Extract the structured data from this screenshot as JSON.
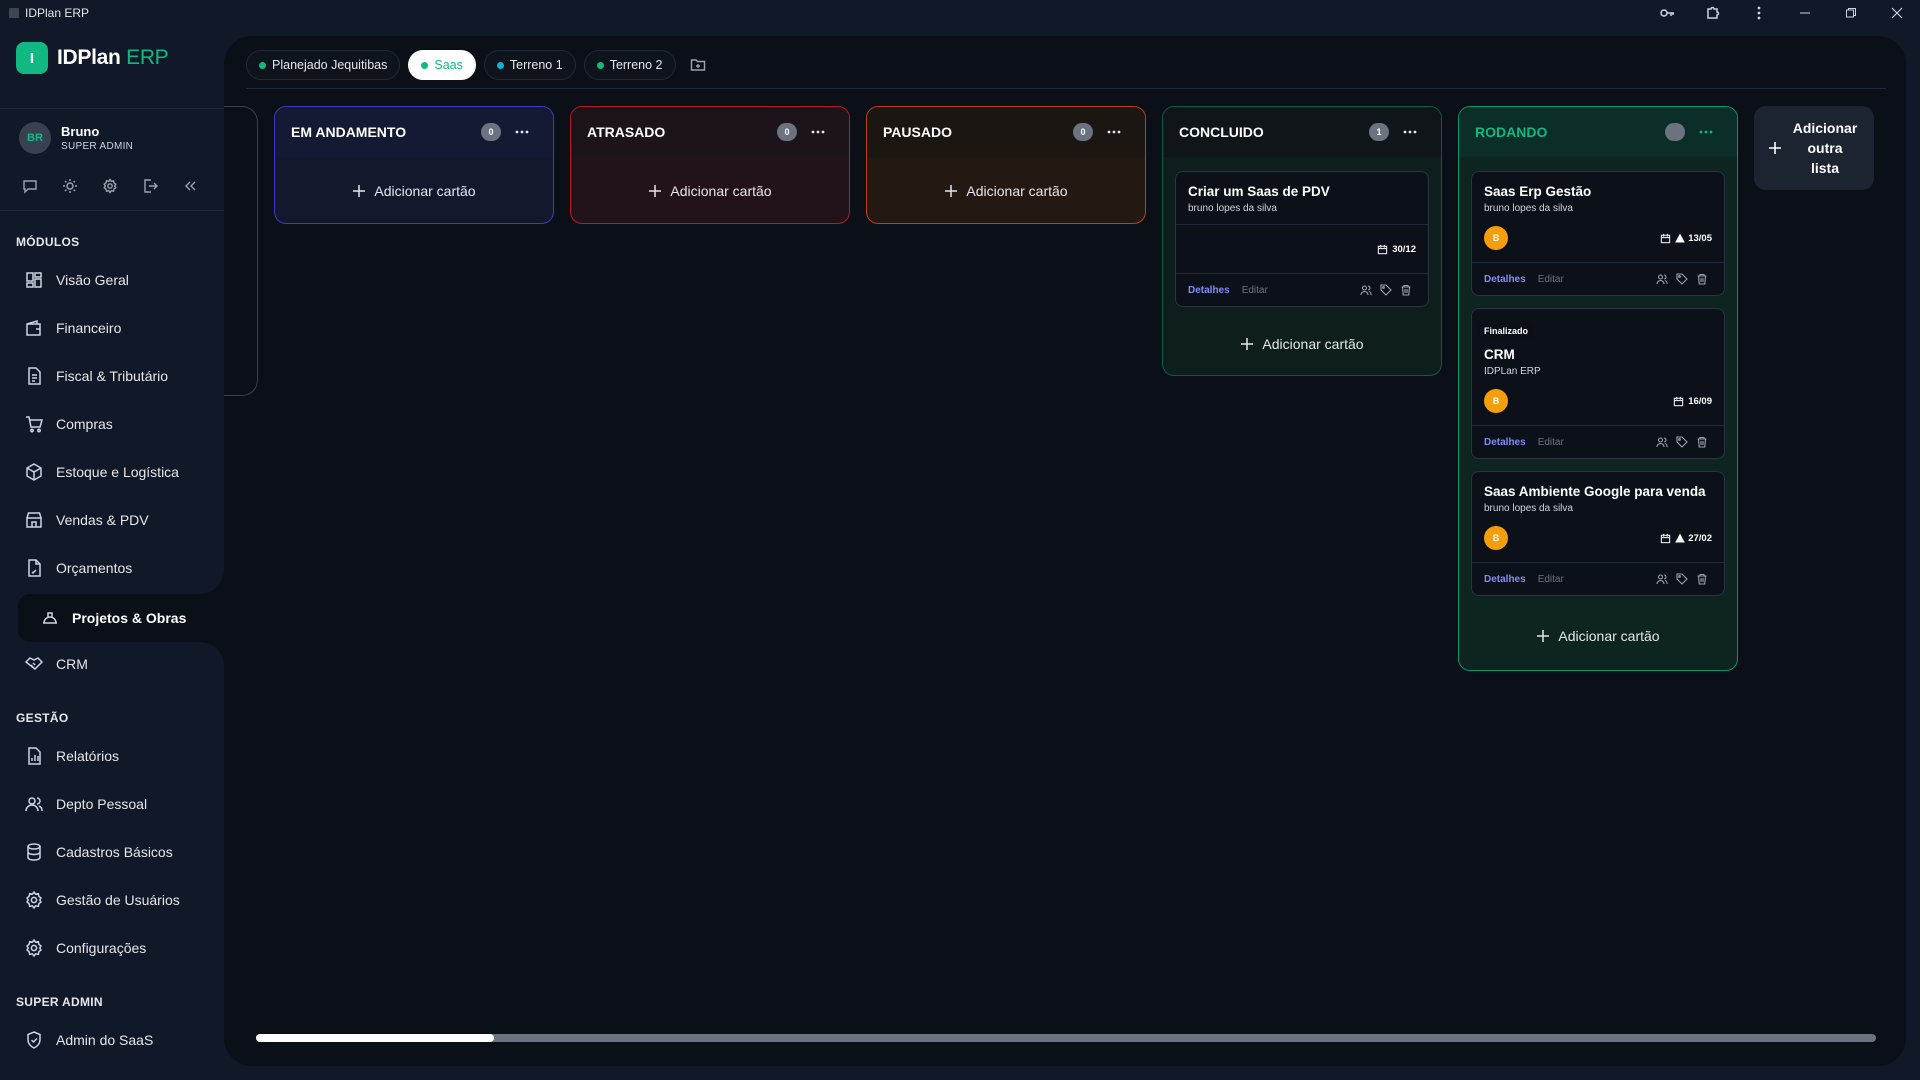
{
  "window": {
    "title": "IDPlan ERP"
  },
  "brand": {
    "mark": "I",
    "name": "IDPlan",
    "suffix": "ERP",
    "accent": "#10b981"
  },
  "user": {
    "initials": "BR",
    "name": "Bruno",
    "role": "SUPER ADMIN"
  },
  "sidebar": {
    "sections": [
      {
        "title": "MÓDULOS",
        "items": [
          {
            "label": "Visão Geral",
            "icon": "dashboard-icon"
          },
          {
            "label": "Financeiro",
            "icon": "wallet-icon"
          },
          {
            "label": "Fiscal & Tributário",
            "icon": "receipt-icon"
          },
          {
            "label": "Compras",
            "icon": "cart-icon"
          },
          {
            "label": "Estoque e Logística",
            "icon": "package-icon"
          },
          {
            "label": "Vendas & PDV",
            "icon": "store-icon"
          },
          {
            "label": "Orçamentos",
            "icon": "document-icon"
          },
          {
            "label": "Projetos & Obras",
            "icon": "hardhat-icon",
            "active": true
          },
          {
            "label": "CRM",
            "icon": "handshake-icon"
          }
        ]
      },
      {
        "title": "GESTÃO",
        "items": [
          {
            "label": "Relatórios",
            "icon": "report-icon"
          },
          {
            "label": "Depto Pessoal",
            "icon": "users-icon"
          },
          {
            "label": "Cadastros Básicos",
            "icon": "database-icon"
          },
          {
            "label": "Gestão de Usuários",
            "icon": "gear-icon"
          },
          {
            "label": "Configurações",
            "icon": "gear-icon"
          }
        ]
      },
      {
        "title": "SUPER ADMIN",
        "items": [
          {
            "label": "Admin do SaaS",
            "icon": "shield-icon"
          }
        ]
      }
    ]
  },
  "tabs": [
    {
      "label": "Planejado Jequitibas",
      "dot": "#10b981"
    },
    {
      "label": "Saas",
      "dot": "#10b981",
      "active": true
    },
    {
      "label": "Terreno 1",
      "dot": "#06b6d4"
    },
    {
      "label": "Terreno 2",
      "dot": "#10b981"
    }
  ],
  "board": {
    "add_card_label": "Adicionar cartão",
    "add_list_label": "Adicionar outra lista",
    "details_label": "Detalhes",
    "edit_label": "Editar",
    "columns": [
      {
        "title": "EM ANDAMENTO",
        "count": "0",
        "border": "#4338ca",
        "head_bg": "#141a33",
        "body_bg": "#14182c"
      },
      {
        "title": "ATRASADO",
        "count": "0",
        "border": "#b91c1c",
        "head_bg": "#1c141a",
        "body_bg": "#22131a"
      },
      {
        "title": "PAUSADO",
        "count": "0",
        "border": "#c2410c",
        "head_bg": "#1c1612",
        "body_bg": "#241812"
      },
      {
        "title": "CONCLUIDO",
        "count": "1",
        "border": "#065f46",
        "head_bg": "#0f1519",
        "body_bg": "#0e1e1c",
        "cards": [
          {
            "title": "Criar um Saas de PDV",
            "subtitle": "bruno lopes da silva",
            "date": "30/12"
          }
        ]
      },
      {
        "title": "RODANDO",
        "count": "",
        "border": "#059669",
        "head_bg": "#0c2e28",
        "body_bg": "#0d2420",
        "cards": [
          {
            "title": "Saas Erp Gestão",
            "subtitle": "bruno lopes da silva",
            "assignee": "B",
            "date": "13/05",
            "warning": true
          },
          {
            "badge": "Finalizado",
            "title": "CRM",
            "subtitle": "IDPLan ERP",
            "assignee": "B",
            "date": "16/09"
          },
          {
            "title": "Saas Ambiente Google para venda",
            "subtitle": "bruno lopes da silva",
            "assignee": "B",
            "date": "27/02",
            "warning": true
          }
        ]
      }
    ]
  },
  "scrollbar": {
    "position": 0.15
  }
}
